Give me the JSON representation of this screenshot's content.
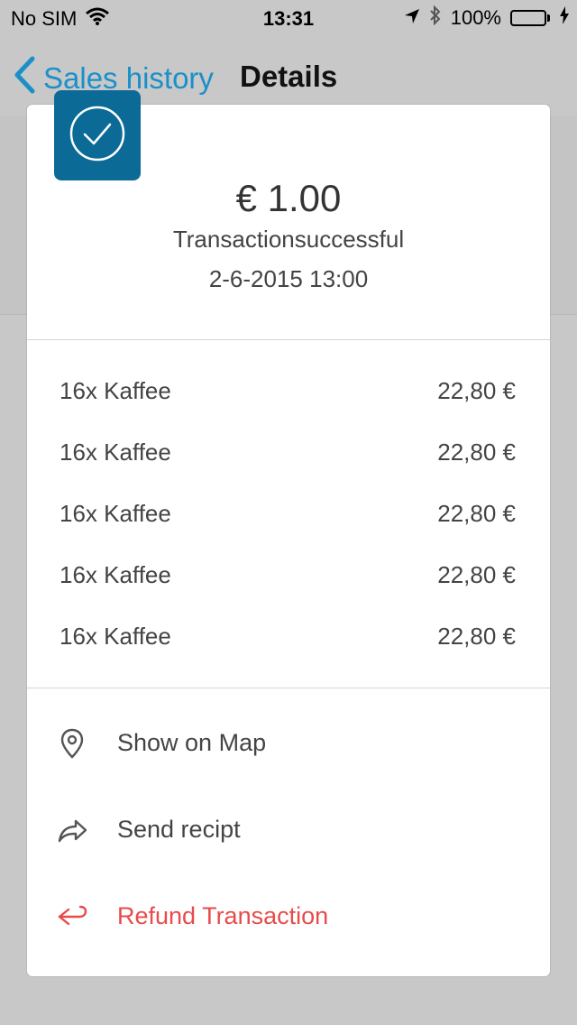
{
  "status_bar": {
    "carrier": "No SIM",
    "time": "13:31",
    "battery": "100%",
    "battery_level": 1.0,
    "battery_color": "#4cd964"
  },
  "nav": {
    "back_label": "Sales history",
    "title": "Details"
  },
  "transaction": {
    "amount": "€ 1.00",
    "status": "Transactionsuccessful",
    "datetime": "2-6-2015  13:00",
    "badge_icon": "checkmark-circle-icon",
    "badge_color": "#0b6b96"
  },
  "items": [
    {
      "name": "16x Kaffee",
      "price": "22,80 €"
    },
    {
      "name": "16x Kaffee",
      "price": "22,80 €"
    },
    {
      "name": "16x Kaffee",
      "price": "22,80 €"
    },
    {
      "name": "16x Kaffee",
      "price": "22,80 €"
    },
    {
      "name": "16x Kaffee",
      "price": "22,80 €"
    }
  ],
  "actions": [
    {
      "label": "Show on Map",
      "icon": "map-pin-icon"
    },
    {
      "label": "Send recipt",
      "icon": "share-arrow-icon"
    },
    {
      "label": "Refund Transaction",
      "icon": "refund-arrow-icon",
      "color": "#e84b4b"
    }
  ],
  "colors": {
    "accent": "#1a90c9",
    "danger": "#e84b4b"
  }
}
